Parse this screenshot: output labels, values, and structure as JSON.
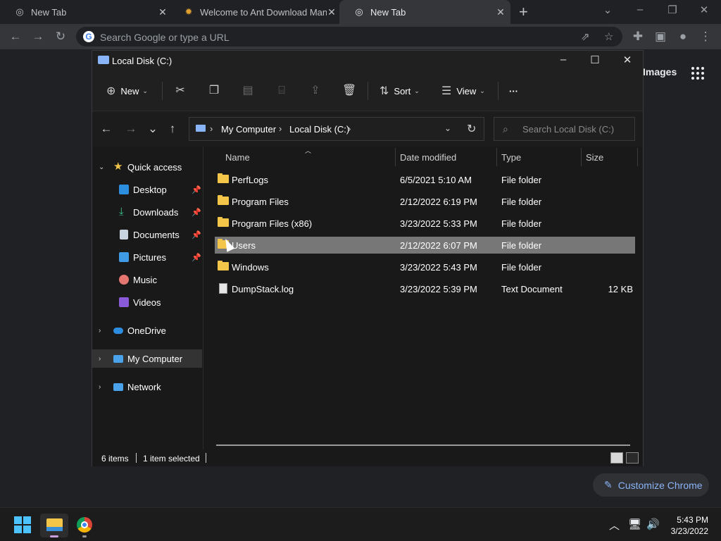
{
  "browser": {
    "tabs": [
      {
        "title": "New Tab",
        "active": false
      },
      {
        "title": "Welcome to Ant Download Manager",
        "active": false
      },
      {
        "title": "New Tab",
        "active": true
      }
    ],
    "new_tab_glyph": "+",
    "omnibox_placeholder": "Search Google or type a URL",
    "page": {
      "images_link": "Images",
      "customize_label": "Customize Chrome"
    }
  },
  "explorer": {
    "title": "Local Disk (C:)",
    "commands": {
      "new_label": "New",
      "sort_label": "Sort",
      "view_label": "View",
      "more_label": "···"
    },
    "address": {
      "crumbs": [
        "My Computer",
        "Local Disk (C:)"
      ],
      "search_placeholder": "Search Local Disk (C:)"
    },
    "sidebar": {
      "quick_access": "Quick access",
      "quick_items": [
        "Desktop",
        "Downloads",
        "Documents",
        "Pictures",
        "Music",
        "Videos"
      ],
      "onedrive": "OneDrive",
      "my_computer": "My Computer",
      "network": "Network"
    },
    "columns": [
      "Name",
      "Date modified",
      "Type",
      "Size"
    ],
    "files": [
      {
        "name": "PerfLogs",
        "date": "6/5/2021 5:10 AM",
        "type": "File folder",
        "size": "",
        "kind": "folder"
      },
      {
        "name": "Program Files",
        "date": "2/12/2022 6:19 PM",
        "type": "File folder",
        "size": "",
        "kind": "folder"
      },
      {
        "name": "Program Files (x86)",
        "date": "3/23/2022 5:33 PM",
        "type": "File folder",
        "size": "",
        "kind": "folder"
      },
      {
        "name": "Users",
        "date": "2/12/2022 6:07 PM",
        "type": "File folder",
        "size": "",
        "kind": "folder",
        "selected": true
      },
      {
        "name": "Windows",
        "date": "3/23/2022 5:43 PM",
        "type": "File folder",
        "size": "",
        "kind": "folder"
      },
      {
        "name": "DumpStack.log",
        "date": "3/23/2022 5:39 PM",
        "type": "Text Document",
        "size": "12 KB",
        "kind": "file"
      }
    ],
    "status": {
      "items": "6 items",
      "selected": "1 item selected"
    }
  },
  "taskbar": {
    "time": "5:43 PM",
    "date": "3/23/2022"
  },
  "colors": {
    "accent": "#4cc2ff",
    "folder": "#f3c64a",
    "selection": "#777777"
  }
}
